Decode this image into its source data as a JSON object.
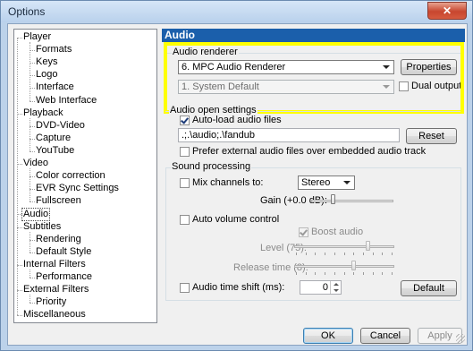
{
  "window": {
    "title": "Options",
    "close_glyph": "✕"
  },
  "tree": {
    "items": [
      {
        "label": "Player",
        "level": 0
      },
      {
        "label": "Formats",
        "level": 1
      },
      {
        "label": "Keys",
        "level": 1
      },
      {
        "label": "Logo",
        "level": 1
      },
      {
        "label": "Interface",
        "level": 1
      },
      {
        "label": "Web Interface",
        "level": 1
      },
      {
        "label": "Playback",
        "level": 0
      },
      {
        "label": "DVD-Video",
        "level": 1
      },
      {
        "label": "Capture",
        "level": 1
      },
      {
        "label": "YouTube",
        "level": 1
      },
      {
        "label": "Video",
        "level": 0
      },
      {
        "label": "Color correction",
        "level": 1
      },
      {
        "label": "EVR Sync Settings",
        "level": 1
      },
      {
        "label": "Fullscreen",
        "level": 1
      },
      {
        "label": "Audio",
        "level": 0,
        "selected": true
      },
      {
        "label": "Subtitles",
        "level": 0
      },
      {
        "label": "Rendering",
        "level": 1
      },
      {
        "label": "Default Style",
        "level": 1
      },
      {
        "label": "Internal Filters",
        "level": 0
      },
      {
        "label": "Performance",
        "level": 1
      },
      {
        "label": "External Filters",
        "level": 0
      },
      {
        "label": "Priority",
        "level": 1
      },
      {
        "label": "Miscellaneous",
        "level": 0
      }
    ]
  },
  "page": {
    "header": "Audio",
    "highlight_color": "#ffff00",
    "renderer": {
      "group_label": "Audio renderer",
      "renderer_value": "6. MPC Audio Renderer",
      "properties_label": "Properties",
      "device_value": "1. System Default",
      "dual_output_label": "Dual output",
      "dual_output_checked": false
    },
    "open": {
      "group_label": "Audio open settings",
      "autoload_label": "Auto-load audio files",
      "autoload_checked": true,
      "paths_value": ".;.\\audio;.\\fandub",
      "reset_label": "Reset",
      "prefer_external_label": "Prefer external audio files over embedded audio track",
      "prefer_external_checked": false
    },
    "processing": {
      "group_label": "Sound processing",
      "mix_label": "Mix channels to:",
      "mix_checked": false,
      "mix_value": "Stereo",
      "gain_label": "Gain (+0.0 dB):",
      "gain_level": 0.25,
      "auto_volume_label": "Auto volume control",
      "auto_volume_checked": false,
      "boost_label": "Boost audio",
      "boost_checked": true,
      "level_label": "Level (75):",
      "level_value": 0.75,
      "release_label": "Release time (8):",
      "release_value": 0.6,
      "timeshift_label": "Audio time shift (ms):",
      "timeshift_checked": false,
      "timeshift_value": "0",
      "default_label": "Default"
    }
  },
  "footer": {
    "ok_label": "OK",
    "cancel_label": "Cancel",
    "apply_label": "Apply"
  }
}
